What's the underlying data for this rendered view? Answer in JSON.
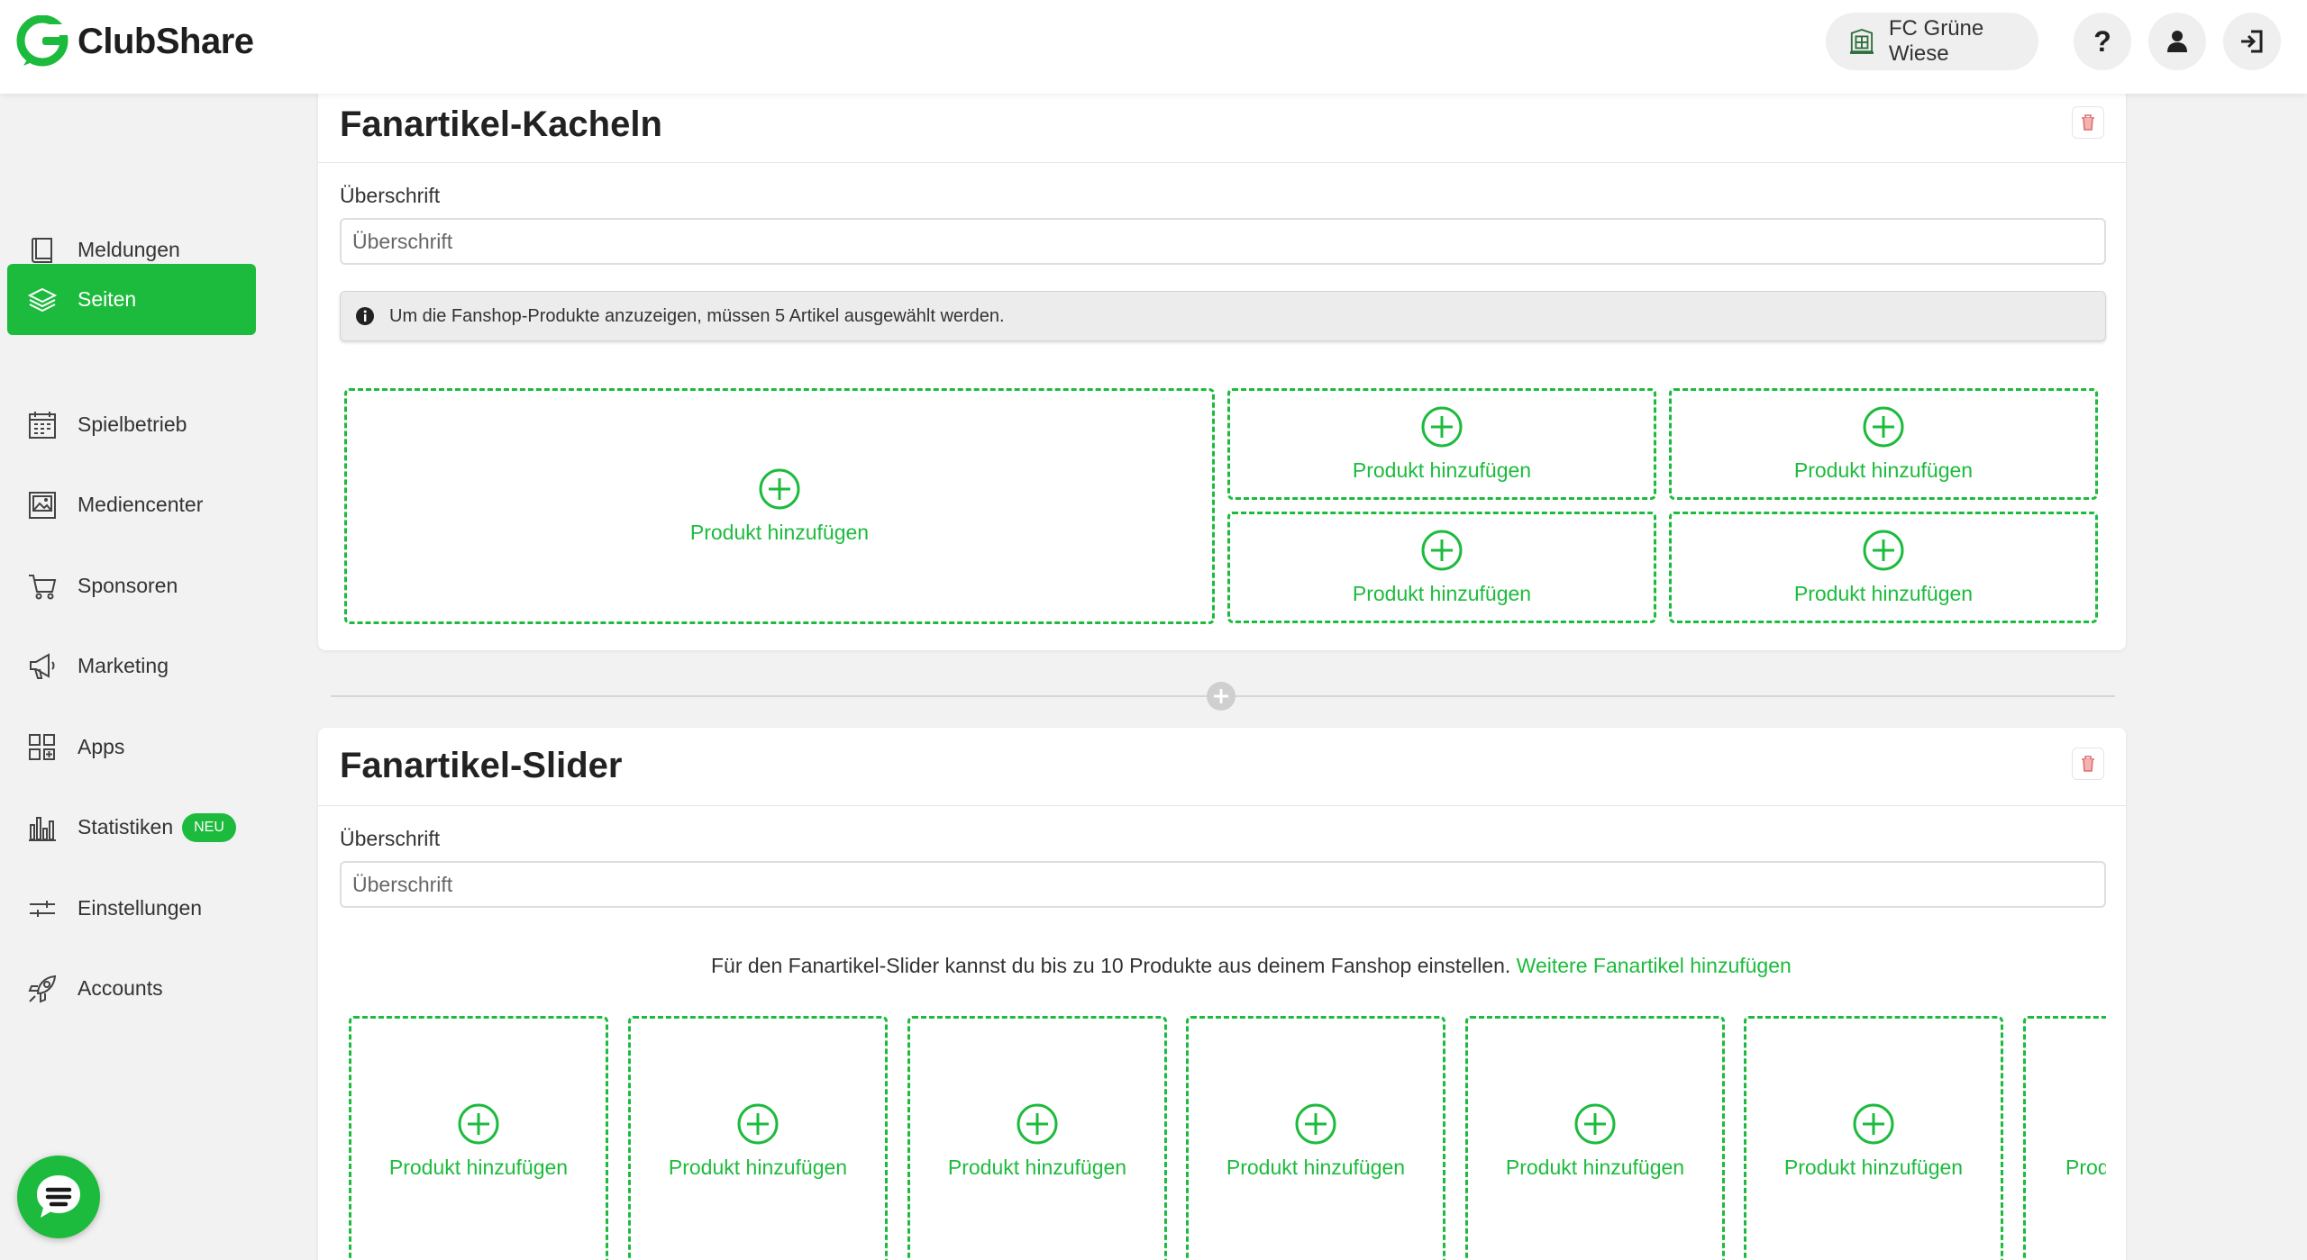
{
  "app": {
    "name": "ClubShare",
    "accent_color": "#1dbb3d"
  },
  "header": {
    "club_name": "FC Grüne Wiese",
    "icons": [
      "club-crest-icon",
      "help-icon",
      "user-icon",
      "logout-icon"
    ],
    "help_glyph": "?"
  },
  "sidebar": {
    "items": [
      {
        "label": "Meldungen",
        "icon": "book-icon"
      },
      {
        "label": "Seiten",
        "icon": "layers-icon",
        "active": true
      },
      {
        "label": "Spielbetrieb",
        "icon": "calendar-icon"
      },
      {
        "label": "Mediencenter",
        "icon": "image-icon"
      },
      {
        "label": "Sponsoren",
        "icon": "cart-icon"
      },
      {
        "label": "Marketing",
        "icon": "megaphone-icon"
      },
      {
        "label": "Apps",
        "icon": "apps-icon"
      },
      {
        "label": "Statistiken",
        "icon": "bar-chart-icon",
        "badge": "NEU"
      },
      {
        "label": "Einstellungen",
        "icon": "sliders-icon"
      },
      {
        "label": "Accounts",
        "icon": "rocket-icon"
      }
    ]
  },
  "tiles_section": {
    "title": "Fanartikel-Kacheln",
    "heading_label": "Überschrift",
    "heading_placeholder": "Überschrift",
    "heading_value": "",
    "info_text": "Um die Fanshop-Produkte anzuzeigen, müssen 5 Artikel ausgewählt werden.",
    "add_product_label": "Produkt hinzufügen",
    "slot_count": 5
  },
  "slider_section": {
    "title": "Fanartikel-Slider",
    "heading_label": "Überschrift",
    "heading_placeholder": "Überschrift",
    "heading_value": "",
    "hint_text": "Für den Fanartikel-Slider kannst du bis zu 10 Produkte aus deinem Fanshop einstellen.",
    "hint_link": "Weitere Fanartikel hinzufügen",
    "add_product_label": "Produkt hinzufügen",
    "visible_slots": 7
  },
  "chat": {
    "icon": "chat-bubble-icon"
  }
}
